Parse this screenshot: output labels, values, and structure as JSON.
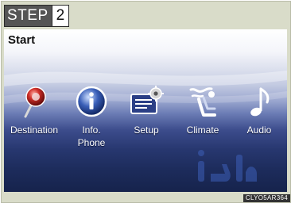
{
  "step": {
    "word": "STEP",
    "number": "2"
  },
  "screen": {
    "title": "Start",
    "menu": [
      {
        "label": "Destination",
        "icon": "destination-pin-icon"
      },
      {
        "label": "Info.\nPhone",
        "icon": "info-icon"
      },
      {
        "label": "Setup",
        "icon": "setup-gear-icon"
      },
      {
        "label": "Climate",
        "icon": "climate-seat-icon"
      },
      {
        "label": "Audio",
        "icon": "music-note-icon"
      }
    ]
  },
  "figure_code": "CLYO5AR364",
  "colors": {
    "screen_top": "#ffffff",
    "screen_bottom": "#16234c",
    "frame": "#d9dcc9",
    "step_badge": "#555555"
  }
}
